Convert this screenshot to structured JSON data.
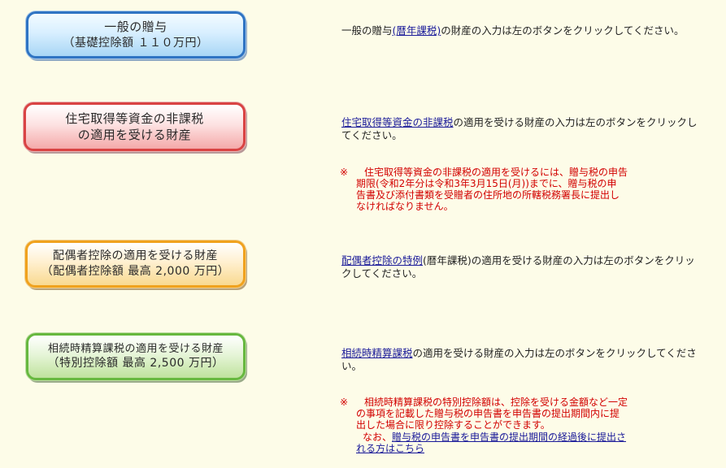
{
  "buttons": {
    "general": {
      "line1": "一般の贈与",
      "line2": "（基礎控除額 １１０万円）"
    },
    "housing": {
      "line1": "住宅取得等資金の非課税",
      "line2": "の適用を受ける財産"
    },
    "spouse": {
      "line1": "配偶者控除の適用を受ける財産",
      "line2": "（配偶者控除額 最高 2,000 万円）"
    },
    "inheritance": {
      "line1": "相続時精算課税の適用を受ける財産",
      "line2": "（特別控除額 最高 2,500 万円）"
    }
  },
  "descriptions": {
    "general": {
      "prefix": "一般の贈与",
      "link": "(暦年課税)",
      "suffix": "の財産の入力は左のボタンをクリックしてください。"
    },
    "housing": {
      "link": "住宅取得等資金の非課税",
      "suffix": "の適用を受ける財産の入力は左のボタンをクリックしてください。"
    },
    "spouse": {
      "link": "配偶者控除の特例",
      "suffix": "(暦年課税)の適用を受ける財産の入力は左のボタンをクリックしてください。"
    },
    "inheritance": {
      "link": "相続時精算課税",
      "suffix": "の適用を受ける財産の入力は左のボタンをクリックしてください。"
    }
  },
  "warnings": {
    "housing": {
      "mark": "※",
      "line1": "住宅取得等資金の非課税の適用を受けるには、贈与税の申告",
      "line2": "期限(令和2年分は令和3年3月15日(月))までに、贈与税の申",
      "line3": "告書及び添付書類を受贈者の住所地の所轄税務署長に提出し",
      "line4": "なければなりません。"
    },
    "inheritance": {
      "mark": "※",
      "line1": "相続時精算課税の特別控除額は、控除を受ける金額など一定",
      "line2": "の事項を記載した贈与税の申告書を申告書の提出期間内に提",
      "line3": "出した場合に限り控除することができます。",
      "note_prefix": "なお、",
      "note_link1": "贈与税の申告書を申告書の提出期間の経過後に提出さ",
      "note_link2": "れる方はこちら"
    }
  },
  "colors": {
    "background": "#fdfce8",
    "link": "#1a1a99",
    "warning": "#d20000"
  }
}
